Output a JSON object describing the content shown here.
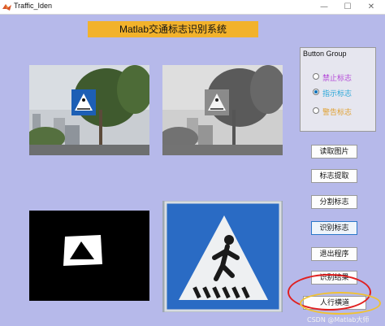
{
  "window": {
    "title": "Traffic_Iden",
    "minimize_glyph": "—",
    "maximize_glyph": "☐",
    "close_glyph": "✕"
  },
  "banner": {
    "title": "Matlab交通标志识别系统"
  },
  "button_group": {
    "title": "Button Group",
    "options": [
      {
        "label": "禁止标志",
        "selected": false,
        "color": "#b44ad8"
      },
      {
        "label": "指示标志",
        "selected": true,
        "color": "#2aa7d8"
      },
      {
        "label": "警告标志",
        "selected": false,
        "color": "#e0a030"
      }
    ]
  },
  "actions": [
    {
      "label": "读取图片"
    },
    {
      "label": "标志提取"
    },
    {
      "label": "分割标志"
    },
    {
      "label": "识别标志"
    },
    {
      "label": "退出程序"
    },
    {
      "label": "识别结果"
    },
    {
      "label": "人行横道"
    }
  ],
  "watermark": "CSDN @Matlab大师",
  "colors": {
    "background": "#b6b9ea",
    "banner": "#f2b22b",
    "highlight_red": "#e02020",
    "highlight_yellow": "#f1c232"
  }
}
